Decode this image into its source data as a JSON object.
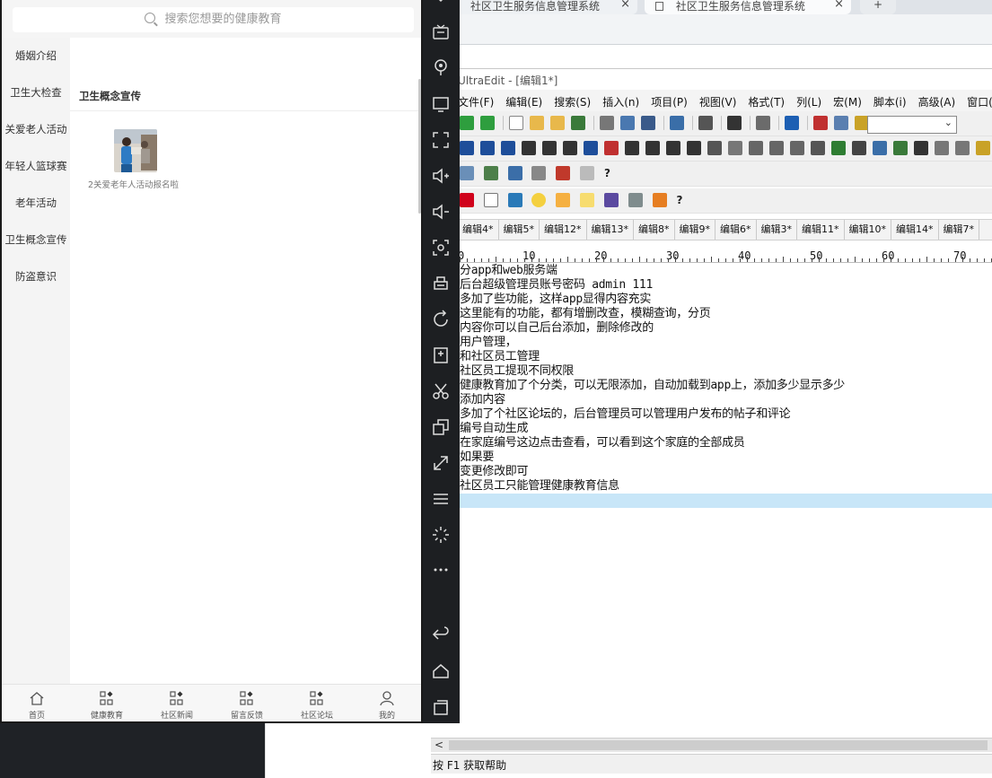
{
  "browser": {
    "tabs": [
      {
        "title": "社区卫生服务信息管理系统",
        "close": "×"
      },
      {
        "title": "社区卫生服务信息管理系统",
        "close": "×"
      }
    ],
    "new_tab": "+"
  },
  "phone": {
    "search_placeholder": "搜索您想要的健康教育",
    "categories": [
      "婚姻介绍",
      "卫生大检查",
      "关爱老人活动",
      "年轻人篮球赛",
      "老年活动",
      "卫生概念宣传",
      "防盗意识"
    ],
    "section_title": "卫生概念宣传",
    "articles": [
      {
        "caption": "2关爱老年人活动报名啦"
      }
    ],
    "tabbar": [
      {
        "label": "首页",
        "icon": "home-icon"
      },
      {
        "label": "健康教育",
        "icon": "grid-icon"
      },
      {
        "label": "社区新闻",
        "icon": "grid-icon"
      },
      {
        "label": "留言反馈",
        "icon": "grid-icon"
      },
      {
        "label": "社区论坛",
        "icon": "grid-icon"
      },
      {
        "label": "我的",
        "icon": "user-icon"
      }
    ]
  },
  "emulator_bar": {
    "buttons": [
      "keyboard-icon",
      "location-icon",
      "screen-icon",
      "fullscreen-icon",
      "volume-up-icon",
      "volume-down-icon",
      "screenshot-icon",
      "print-icon",
      "rotate-icon",
      "apk-install-icon",
      "cut-icon",
      "multi-window-icon",
      "resize-icon",
      "menu-icon",
      "loading-icon",
      "more-icon",
      "back-icon",
      "home-icon",
      "recent-apps-icon"
    ]
  },
  "editor": {
    "title": "UltraEdit - [编辑1*]",
    "menu": [
      "文件(F)",
      "编辑(E)",
      "搜索(S)",
      "插入(n)",
      "项目(P)",
      "视图(V)",
      "格式(T)",
      "列(L)",
      "宏(M)",
      "脚本(i)",
      "高级(A)",
      "窗口(V"
    ],
    "doc_tabs": [
      "编辑4*",
      "编辑5*",
      "编辑12*",
      "编辑13*",
      "编辑8*",
      "编辑9*",
      "编辑6*",
      "编辑3*",
      "编辑11*",
      "编辑10*",
      "编辑14*",
      "编辑7*"
    ],
    "ruler": [
      "0",
      "10",
      "20",
      "30",
      "40",
      "50",
      "60",
      "70"
    ],
    "lines": [
      "分app和web服务端",
      "后台超级管理员账号密码 admin 111",
      "多加了些功能，这样app显得内容充实",
      "这里能有的功能，都有增删改查，模糊查询，分页",
      "内容你可以自己后台添加，删除修改的",
      "用户管理，",
      "和社区员工管理",
      "社区员工提现不同权限",
      "健康教育加了个分类，可以无限添加，自动加载到app上，添加多少显示多少",
      "添加内容",
      "多加了个社区论坛的，后台管理员可以管理用户发布的帖子和评论",
      "编号自动生成",
      "在家庭编号这边点击查看，可以看到这个家庭的全部成员",
      "如果要",
      "变更修改即可",
      "社区员工只能管理健康教育信息"
    ],
    "toolbar_help": "?",
    "hscroll_arrow": "<",
    "status": "按 F1 获取帮助"
  },
  "colors": {
    "phone_bg": "#ffffff",
    "sidebar_bg": "#f4f4f4",
    "emu_bar_bg": "#1d1f22",
    "cursor_line": "#c8e6f8"
  }
}
